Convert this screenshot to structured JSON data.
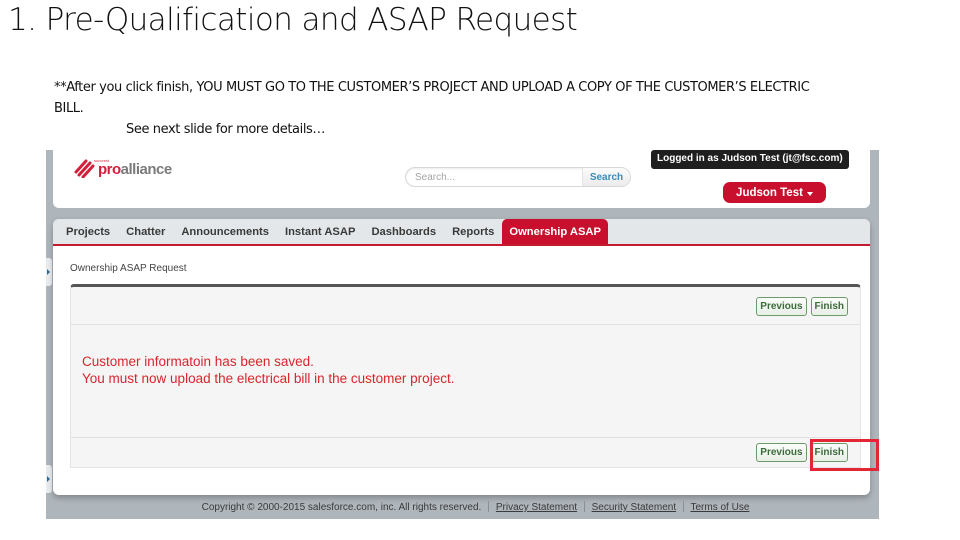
{
  "slide": {
    "title": "1. Pre-Qualification and ASAP Request",
    "note_line1": "**After you click finish, YOU MUST GO TO THE CUSTOMER’S PROJECT AND UPLOAD A COPY OF THE CUSTOMER’S ELECTRIC BILL.",
    "note_line2": "See next slide for more details…"
  },
  "app": {
    "logo": {
      "sub": "suncrest",
      "pro": "pro",
      "alliance": "alliance"
    },
    "search": {
      "placeholder": "Search...",
      "button_label": "Search"
    },
    "logged_in_text": "Logged in as Judson Test (jt@fsc.com)",
    "user_menu_label": "Judson Test",
    "tabs": [
      {
        "label": "Projects",
        "active": false
      },
      {
        "label": "Chatter",
        "active": false
      },
      {
        "label": "Announcements",
        "active": false
      },
      {
        "label": "Instant ASAP",
        "active": false
      },
      {
        "label": "Dashboards",
        "active": false
      },
      {
        "label": "Reports",
        "active": false
      },
      {
        "label": "Ownership ASAP",
        "active": true
      }
    ],
    "page_label": "Ownership ASAP Request",
    "buttons": {
      "previous": "Previous",
      "finish": "Finish"
    },
    "message": {
      "line1": "Customer informatoin has been saved.",
      "line2": "You must now upload the electrical bill in the customer project."
    },
    "footer": {
      "copyright": "Copyright © 2000-2015 salesforce.com, inc. All rights reserved.",
      "links": [
        "Privacy Statement",
        "Security Statement",
        "Terms of Use"
      ]
    }
  },
  "colors": {
    "brand_red": "#c8102e",
    "message_red": "#d9252c",
    "highlight_red": "#e32636",
    "button_green": "#3c6b3a",
    "search_blue": "#3a8bb8"
  }
}
